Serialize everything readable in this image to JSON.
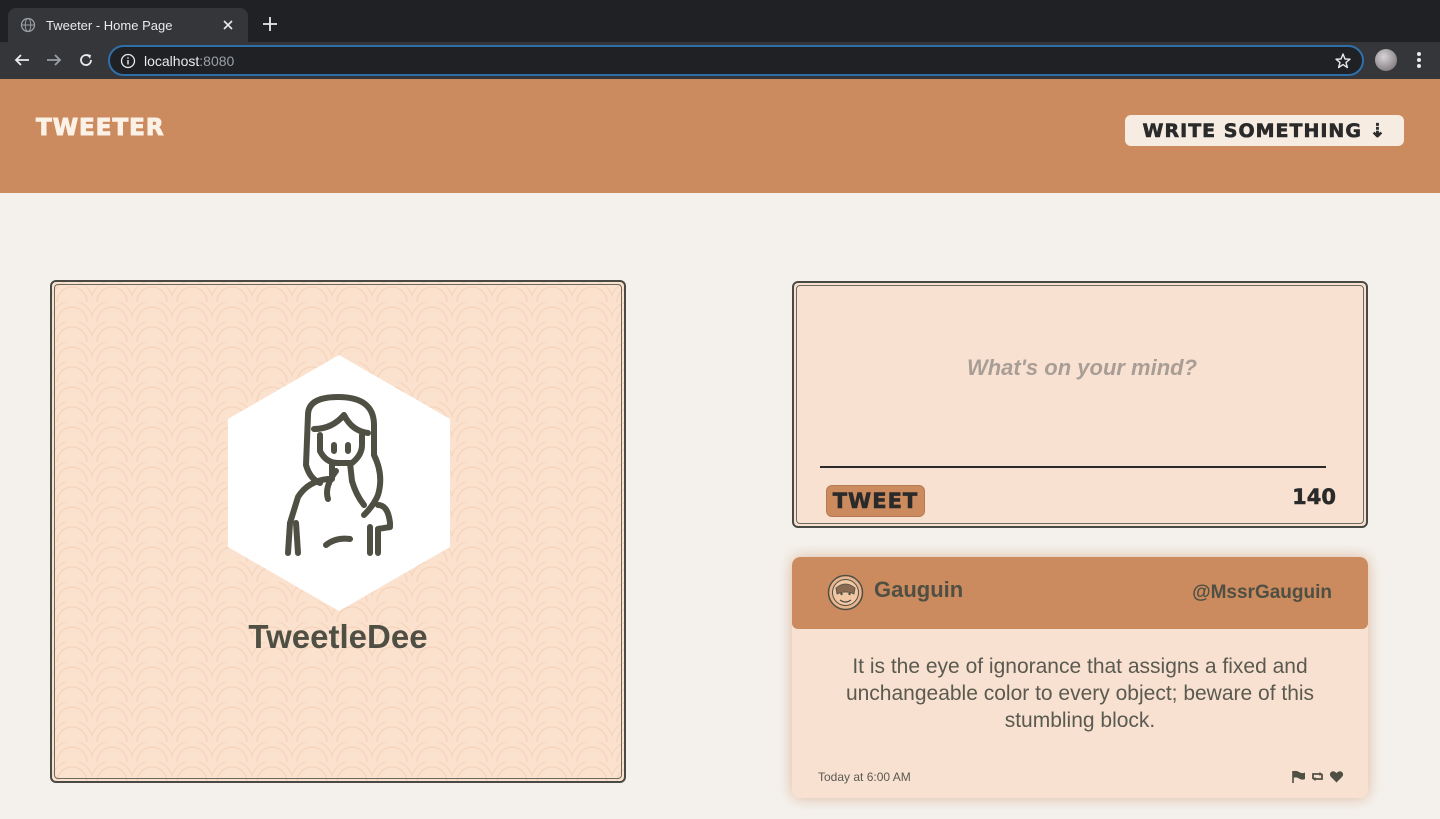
{
  "browser": {
    "tab_title": "Tweeter - Home Page",
    "url_host": "localhost",
    "url_port": ":8080"
  },
  "header": {
    "logo": "Tweeter",
    "write_button": "Write Something ⇣"
  },
  "profile": {
    "username": "TweetleDee"
  },
  "compose": {
    "placeholder": "What's on your mind?",
    "submit_label": "Tweet",
    "char_count": "140"
  },
  "tweet": {
    "author": "Gauguin",
    "handle": "@MssrGauguin",
    "text": "It is the eye of ignorance that assigns a fixed and unchangeable color to every object; beware of this stumbling block.",
    "timestamp": "Today at 6:00 AM",
    "icons": [
      "flag-icon",
      "retweet-icon",
      "heart-icon"
    ]
  },
  "colors": {
    "accent": "#cc8b5e",
    "card_bg": "#f9e1d2",
    "page_bg": "#f4f1ec",
    "text_dark": "#4f4f44"
  }
}
